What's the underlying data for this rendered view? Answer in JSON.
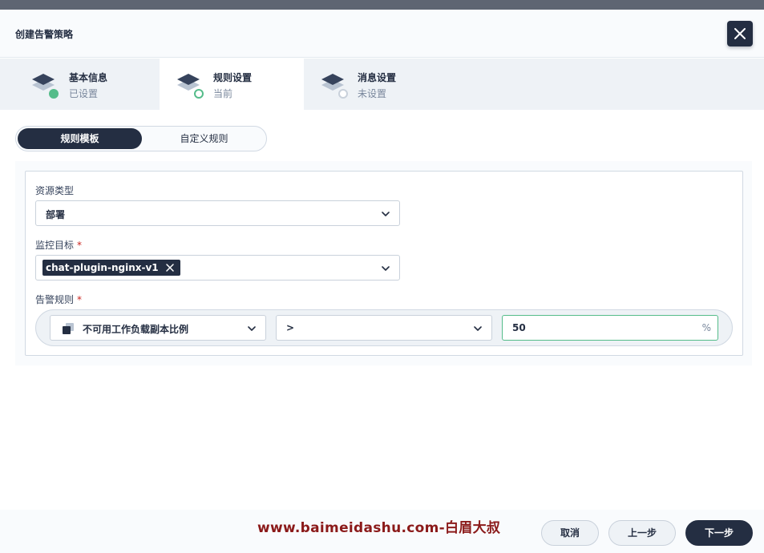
{
  "header": {
    "title": "创建告警策略"
  },
  "steps": [
    {
      "title": "基本信息",
      "status": "已设置"
    },
    {
      "title": "规则设置",
      "status": "当前"
    },
    {
      "title": "消息设置",
      "status": "未设置"
    }
  ],
  "tabs": {
    "template": "规则模板",
    "custom": "自定义规则"
  },
  "form": {
    "resource_type": {
      "label": "资源类型",
      "value": "部署"
    },
    "monitor_target": {
      "label": "监控目标",
      "required_mark": "*",
      "tag": "chat-plugin-nginx-v1"
    },
    "alert_rule": {
      "label": "告警规则",
      "required_mark": "*",
      "metric": "不可用工作负载副本比例",
      "operator": ">",
      "threshold": "50",
      "unit": "%"
    }
  },
  "footer": {
    "cancel": "取消",
    "prev": "上一步",
    "next": "下一步"
  },
  "watermark": "www.baimeidashu.com-白眉大叔",
  "colors": {
    "primary": "#242e42",
    "success": "#55bc8a",
    "required": "#ca2621",
    "watermark": "#8b1a1a"
  }
}
